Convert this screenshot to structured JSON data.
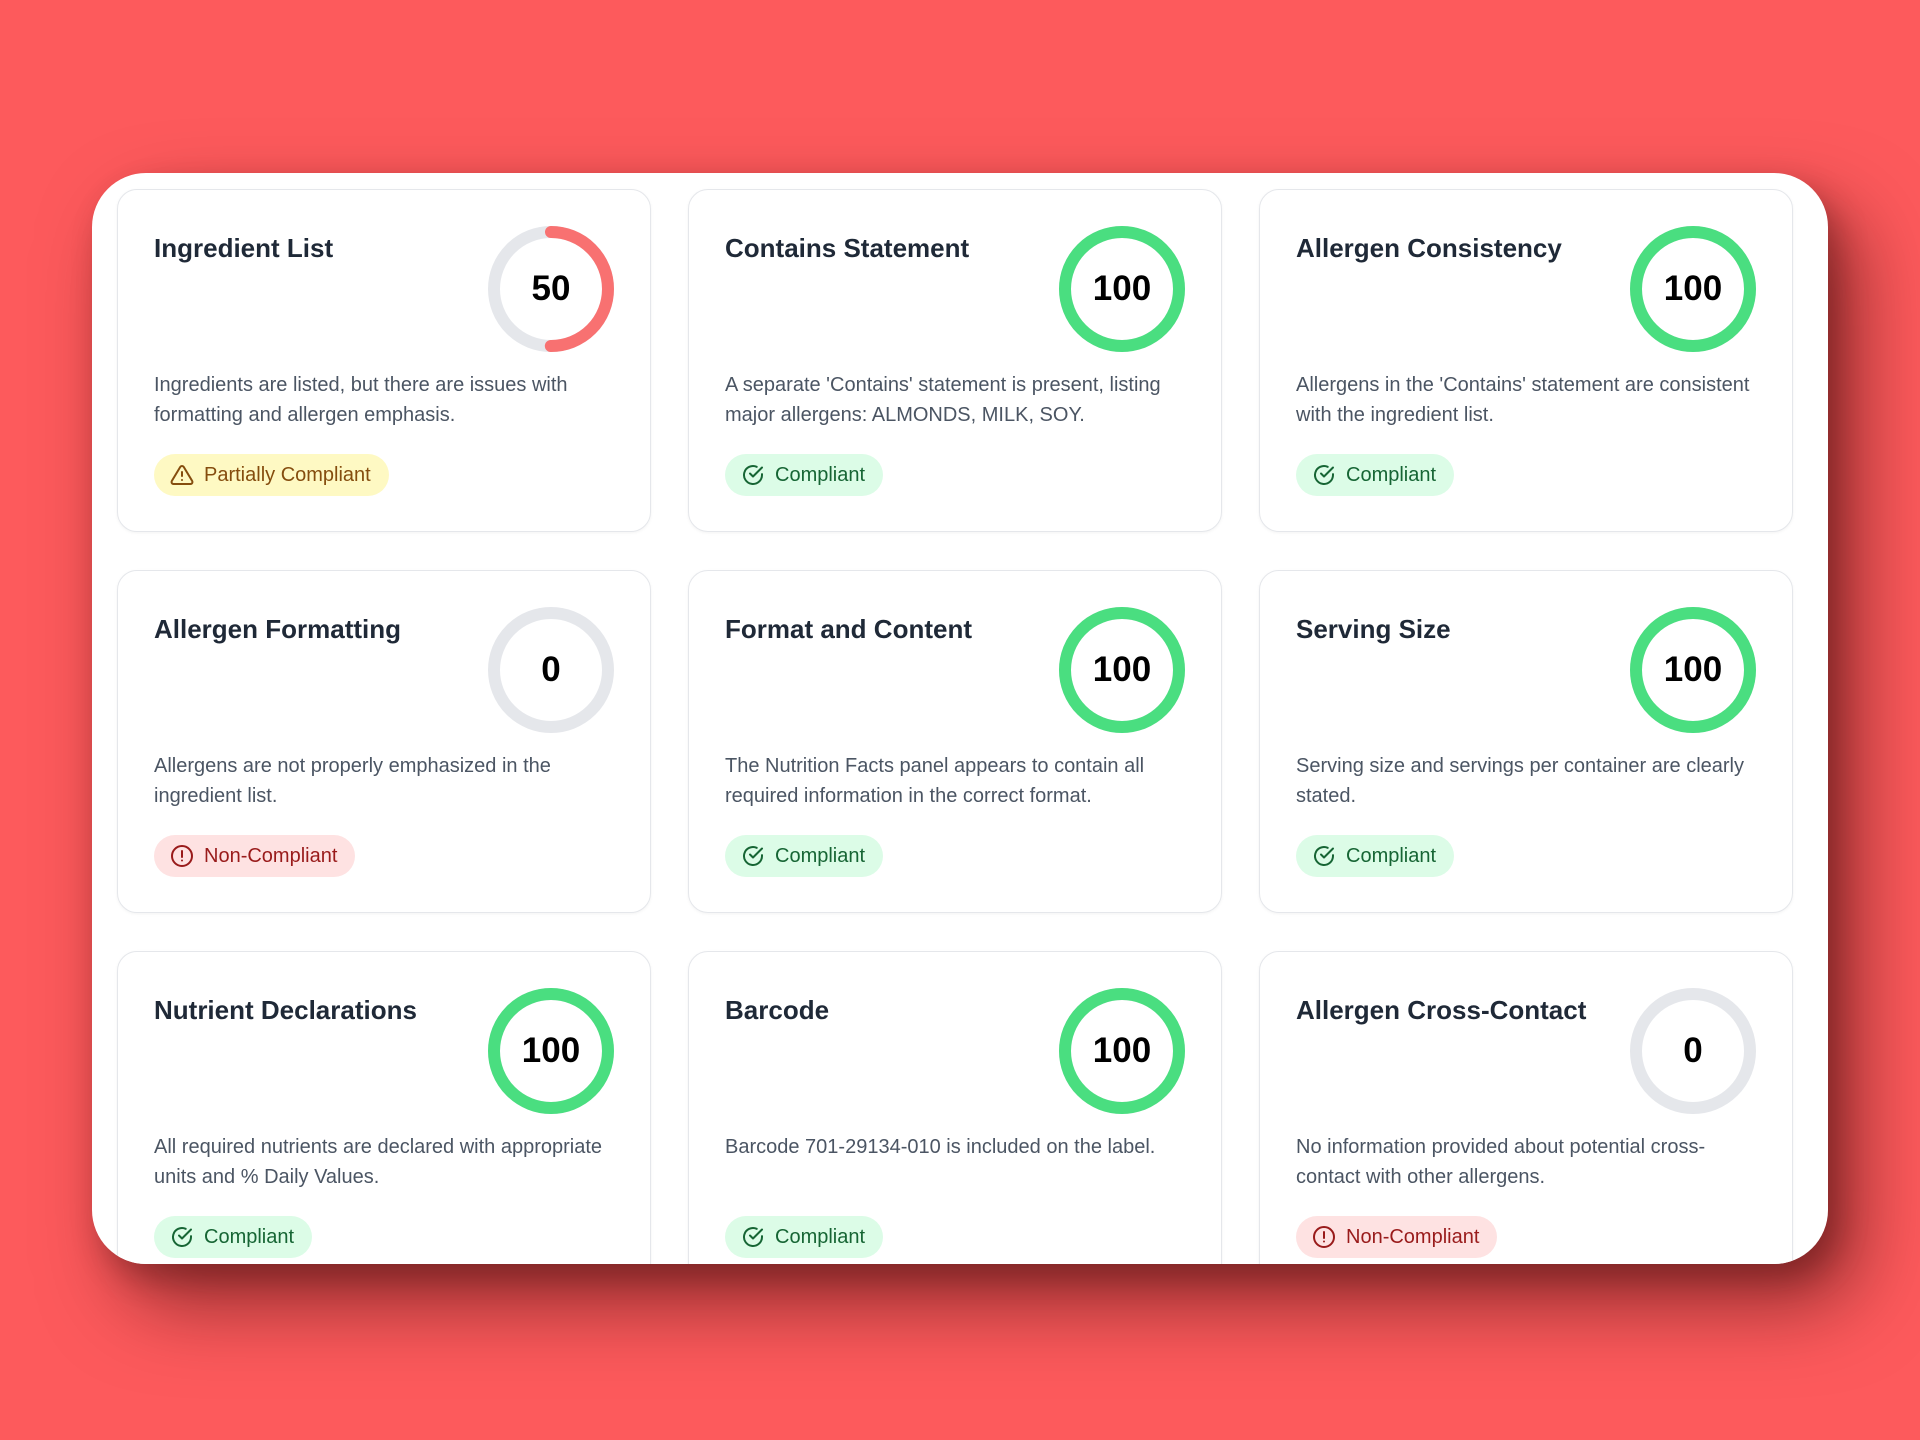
{
  "colors": {
    "background": "#fd5a5c",
    "compliant": "#4ade80",
    "partial": "#f87171",
    "track": "#e5e7eb"
  },
  "cards": [
    {
      "title": "Ingredient List",
      "score": "50",
      "score_value": 50,
      "description": "Ingredients are listed, but there are issues with formatting and allergen emphasis.",
      "status": "Partially Compliant",
      "status_type": "warn",
      "icon": "warning-triangle-icon"
    },
    {
      "title": "Contains Statement",
      "score": "100",
      "score_value": 100,
      "description": "A separate 'Contains' statement is present, listing major allergens: ALMONDS, MILK, SOY.",
      "status": "Compliant",
      "status_type": "ok",
      "icon": "check-circle-icon"
    },
    {
      "title": "Allergen Consistency",
      "score": "100",
      "score_value": 100,
      "description": "Allergens in the 'Contains' statement are consistent with the ingredient list.",
      "status": "Compliant",
      "status_type": "ok",
      "icon": "check-circle-icon"
    },
    {
      "title": "Allergen Formatting",
      "score": "0",
      "score_value": 0,
      "description": "Allergens are not properly emphasized in the ingredient list.",
      "status": "Non-Compliant",
      "status_type": "bad",
      "icon": "alert-circle-icon"
    },
    {
      "title": "Format and Content",
      "score": "100",
      "score_value": 100,
      "description": "The Nutrition Facts panel appears to contain all required information in the correct format.",
      "status": "Compliant",
      "status_type": "ok",
      "icon": "check-circle-icon"
    },
    {
      "title": "Serving Size",
      "score": "100",
      "score_value": 100,
      "description": "Serving size and servings per container are clearly stated.",
      "status": "Compliant",
      "status_type": "ok",
      "icon": "check-circle-icon"
    },
    {
      "title": "Nutrient Declarations",
      "score": "100",
      "score_value": 100,
      "description": "All required nutrients are declared with appropriate units and % Daily Values.",
      "status": "Compliant",
      "status_type": "ok",
      "icon": "check-circle-icon"
    },
    {
      "title": "Barcode",
      "score": "100",
      "score_value": 100,
      "description": "Barcode 701-29134-010 is included on the label.",
      "status": "Compliant",
      "status_type": "ok",
      "icon": "check-circle-icon"
    },
    {
      "title": "Allergen Cross-Contact",
      "score": "0",
      "score_value": 0,
      "description": "No information provided about potential cross-contact with other allergens.",
      "status": "Non-Compliant",
      "status_type": "bad",
      "icon": "alert-circle-icon"
    }
  ]
}
